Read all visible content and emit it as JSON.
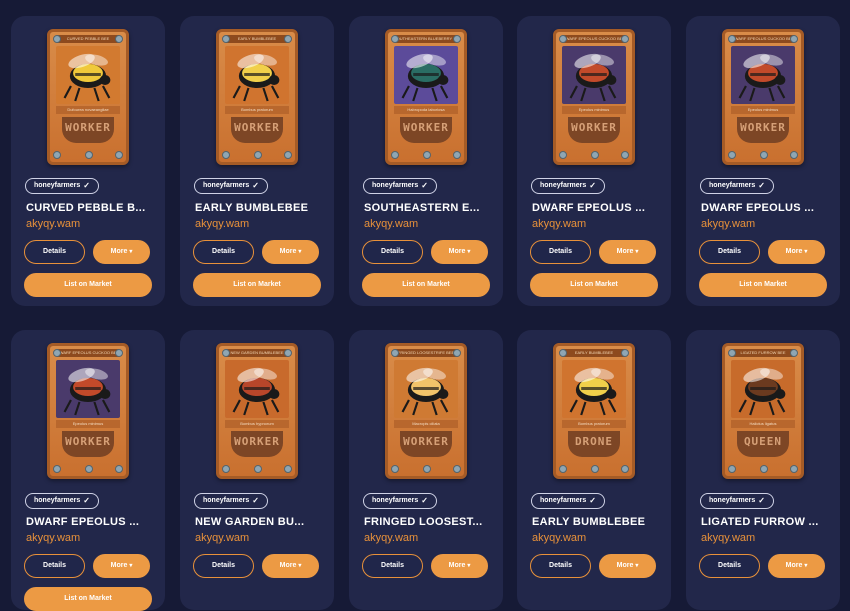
{
  "cards": [
    {
      "collection": "honeyfarmers",
      "name": "CURVED PEBBLE B...",
      "owner": "akyqy.wam",
      "details_label": "Details",
      "more_label": "More",
      "list_label": "List on Market",
      "role": "WORKER",
      "banner": "CURVED PEBBLE BEE",
      "latin": "Dufourea novaeangliae",
      "art_bg": "#d27a30",
      "bee_color": "#f0c93a",
      "row": 0
    },
    {
      "collection": "honeyfarmers",
      "name": "EARLY BUMBLEBEE",
      "owner": "akyqy.wam",
      "details_label": "Details",
      "more_label": "More",
      "list_label": "List on Market",
      "role": "WORKER",
      "banner": "EARLY BUMBLEBEE",
      "latin": "Bombus pratorum",
      "art_bg": "#d0742f",
      "bee_color": "#f1d04a",
      "row": 0
    },
    {
      "collection": "honeyfarmers",
      "name": "SOUTHEASTERN E...",
      "owner": "akyqy.wam",
      "details_label": "Details",
      "more_label": "More",
      "list_label": "List on Market",
      "role": "WORKER",
      "banner": "SOUTHEASTERN BLUEBERRY BEE",
      "latin": "Habropoda laboriosa",
      "art_bg": "#5c4b9a",
      "bee_color": "#2a6d64",
      "row": 0
    },
    {
      "collection": "honeyfarmers",
      "name": "DWARF EPEOLUS ...",
      "owner": "akyqy.wam",
      "details_label": "Details",
      "more_label": "More",
      "list_label": "List on Market",
      "role": "WORKER",
      "banner": "DWARF EPEOLUS CUCKOO BEE",
      "latin": "Epeolus minimus",
      "art_bg": "#4a3a6b",
      "bee_color": "#c24a2a",
      "row": 0
    },
    {
      "collection": "honeyfarmers",
      "name": "DWARF EPEOLUS ...",
      "owner": "akyqy.wam",
      "details_label": "Details",
      "more_label": "More",
      "list_label": "List on Market",
      "role": "WORKER",
      "banner": "DWARF EPEOLUS CUCKOO BEE",
      "latin": "Epeolus minimus",
      "art_bg": "#4a3a6b",
      "bee_color": "#c24a2a",
      "row": 0
    },
    {
      "collection": "honeyfarmers",
      "name": "DWARF EPEOLUS ...",
      "owner": "akyqy.wam",
      "details_label": "Details",
      "more_label": "More",
      "list_label": "List on Market",
      "role": "WORKER",
      "banner": "DWARF EPEOLUS CUCKOO BEE",
      "latin": "Epeolus minimus",
      "art_bg": "#4a3a6b",
      "bee_color": "#c24a2a",
      "row": 1
    },
    {
      "collection": "honeyfarmers",
      "name": "NEW GARDEN BU...",
      "owner": "akyqy.wam",
      "details_label": "Details",
      "more_label": "More",
      "list_label": "",
      "role": "WORKER",
      "banner": "NEW GARDEN BUMBLEBEE",
      "latin": "Bombus hypnorum",
      "art_bg": "#c86a2c",
      "bee_color": "#b8462a",
      "row": 1
    },
    {
      "collection": "honeyfarmers",
      "name": "FRINGED LOOSEST...",
      "owner": "akyqy.wam",
      "details_label": "Details",
      "more_label": "More",
      "list_label": "",
      "role": "WORKER",
      "banner": "FRINGED LOOSESTRIFE BEE",
      "latin": "Macropis ciliata",
      "art_bg": "#cf7a33",
      "bee_color": "#f2c46a",
      "row": 1
    },
    {
      "collection": "honeyfarmers",
      "name": "EARLY BUMBLEBEE",
      "owner": "akyqy.wam",
      "details_label": "Details",
      "more_label": "More",
      "list_label": "",
      "role": "DRONE",
      "banner": "EARLY BUMBLEBEE",
      "latin": "Bombus pratorum",
      "art_bg": "#d0742f",
      "bee_color": "#f1d04a",
      "row": 1
    },
    {
      "collection": "honeyfarmers",
      "name": "LIGATED FURROW ...",
      "owner": "akyqy.wam",
      "details_label": "Details",
      "more_label": "More",
      "list_label": "",
      "role": "QUEEN",
      "banner": "LIGATED FURROW BEE",
      "latin": "Halictus ligatus",
      "art_bg": "#c76b2b",
      "bee_color": "#6b3a1f",
      "row": 1
    }
  ]
}
